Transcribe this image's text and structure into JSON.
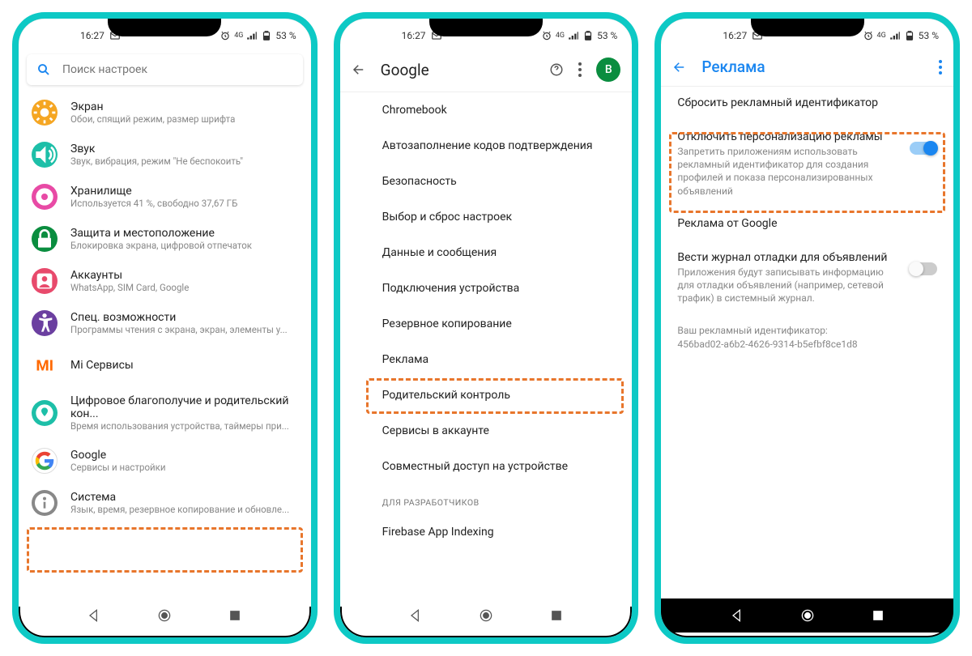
{
  "status": {
    "time": "16:27",
    "battery": "53 %",
    "net": "4G"
  },
  "phone1": {
    "search_placeholder": "Поиск настроек",
    "items": [
      {
        "title": "Экран",
        "sub": "Обои, спящий режим, размер шрифта",
        "color": "#f5a623",
        "icon": "sun"
      },
      {
        "title": "Звук",
        "sub": "Звук, вибрация, режим \"Не беспокоить\"",
        "color": "#1dbfa8",
        "icon": "volume"
      },
      {
        "title": "Хранилище",
        "sub": "Используется 41 %, свободно 37,67 ГБ",
        "color": "#e84aa5",
        "icon": "storage"
      },
      {
        "title": "Защита и местоположение",
        "sub": "Блокировка экрана, цифровой отпечаток",
        "color": "#0a8d3f",
        "icon": "lock"
      },
      {
        "title": "Аккаунты",
        "sub": "WhatsApp, SIM Card, Google",
        "color": "#e84a6c",
        "icon": "account"
      },
      {
        "title": "Спец. возможности",
        "sub": "Программы чтения с экрана, экран, элементы у...",
        "color": "#6b3fa0",
        "icon": "a11y"
      },
      {
        "title": "Mi Сервисы",
        "sub": "",
        "color": "#ff6900",
        "icon": "mi"
      },
      {
        "title": "Цифровое благополучие и родительский кон...",
        "sub": "Время использования устройства, таймеры при...",
        "color": "#1dbfa8",
        "icon": "wellbeing"
      },
      {
        "title": "Google",
        "sub": "Сервисы и настройки",
        "color": "#fff",
        "icon": "google"
      },
      {
        "title": "Система",
        "sub": "Язык, время, резервное копирование и обновле...",
        "color": "#888",
        "icon": "info"
      }
    ]
  },
  "phone2": {
    "title": "Google",
    "avatar_letter": "B",
    "items": [
      "Chromebook",
      "Автозаполнение кодов подтверждения",
      "Безопасность",
      "Выбор и сброс настроек",
      "Данные и сообщения",
      "Подключения устройства",
      "Резервное копирование",
      "Реклама",
      "Родительский контроль",
      "Сервисы в аккаунте",
      "Совместный доступ на устройстве"
    ],
    "section": "ДЛЯ РАЗРАБОТЧИКОВ",
    "dev_items": [
      "Firebase App Indexing"
    ]
  },
  "phone3": {
    "title": "Реклама",
    "items": [
      {
        "title": "Сбросить рекламный идентификатор",
        "sub": "",
        "toggle": null
      },
      {
        "title": "Отключить персонализацию рекламы",
        "sub": "Запретить приложениям использовать рекламный идентификатор для создания профилей и показа персонализированных объявлений",
        "toggle": "on"
      },
      {
        "title": "Реклама от Google",
        "sub": "",
        "toggle": null
      },
      {
        "title": "Вести журнал отладки для объявлений",
        "sub": "Приложения будут записывать информацию для отладки объявлений (например, сетевой трафик) в системный журнал.",
        "toggle": "off"
      }
    ],
    "ad_id_label": "Ваш рекламный идентификатор:",
    "ad_id_value": "456bad02-a6b2-4626-9314-b5efbf8ce1d8"
  }
}
